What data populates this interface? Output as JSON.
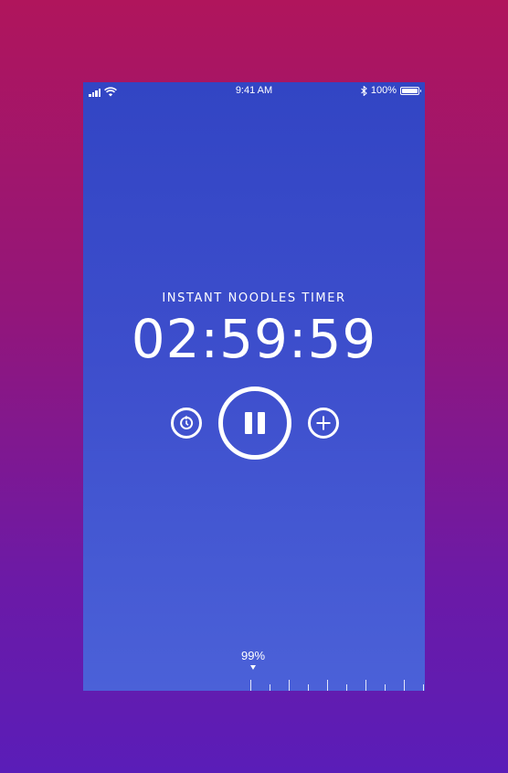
{
  "status_bar": {
    "time": "9:41 AM",
    "battery": "100%",
    "icons": [
      "signal-icon",
      "wifi-icon",
      "bluetooth-icon",
      "battery-icon"
    ]
  },
  "timer": {
    "label": "INSTANT NOODLES TIMER",
    "value": "02:59:59",
    "state": "running"
  },
  "controls": {
    "reset_icon": "reset-icon",
    "pause_icon": "pause-icon",
    "add_icon": "plus-icon"
  },
  "progress": {
    "label": "99%",
    "value": 0.99
  },
  "colors": {
    "background_top": "#b0155c",
    "background_bottom": "#5a1db8",
    "screen_top": "#3245c4",
    "screen_bottom": "#4b61d8",
    "foreground": "#ffffff"
  }
}
